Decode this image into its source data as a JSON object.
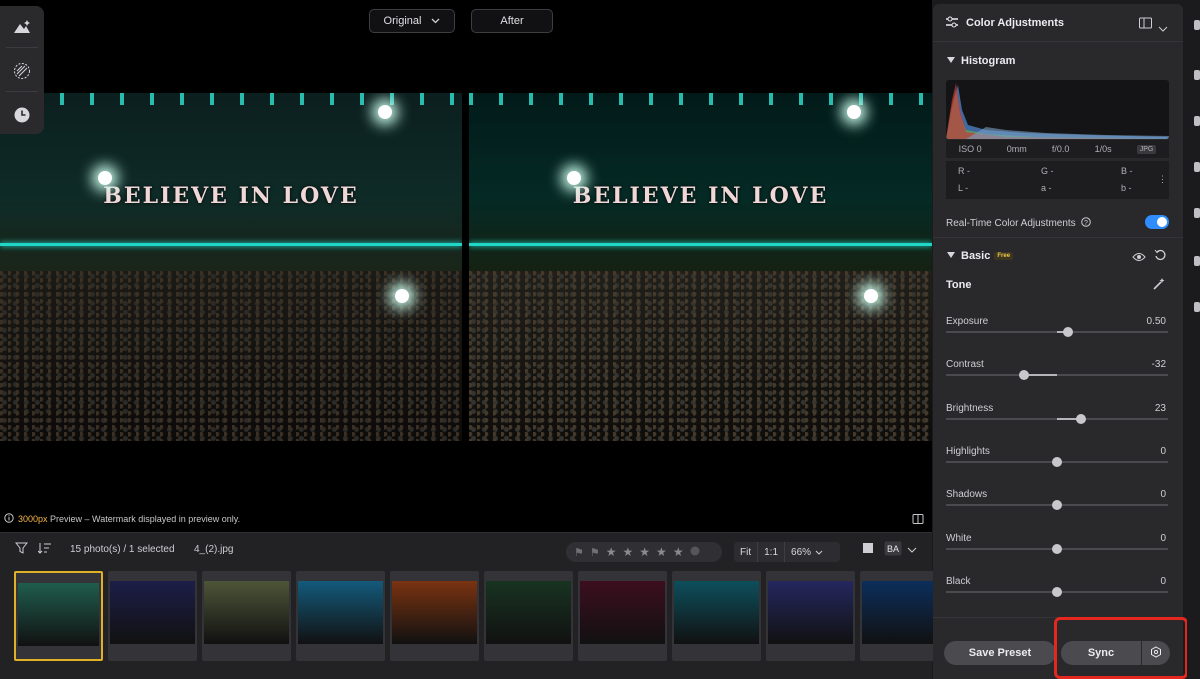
{
  "preview": {
    "compare_mode": "Original",
    "after_label": "After",
    "banner_text": "BELIEVE IN LOVE",
    "info_highlight": "3000px",
    "info_text": " Preview – Watermark displayed in preview only."
  },
  "filmstrip": {
    "count_text": "15 photo(s) / 1 selected",
    "filename": "4_(2).jpg",
    "zoom_fit": "Fit",
    "zoom_1to1": "1:1",
    "zoom_pct": "66%",
    "thumb_colors": [
      "#1f5d4c",
      "#1c1e48",
      "#4d5538",
      "#135a7b",
      "#7a3311",
      "#183321",
      "#3c0e1e",
      "#0d4f5c",
      "#24275e",
      "#0c2e5b"
    ]
  },
  "panel": {
    "title": "Color Adjustments",
    "histogram_title": "Histogram",
    "exif": [
      "ISO 0",
      "0mm",
      "f/0.0",
      "1/0s"
    ],
    "exif_format": "JPG",
    "rgb": {
      "r": "R -",
      "g": "G -",
      "b": "B -",
      "l": "L -",
      "a": "a -",
      "b2": "b -"
    },
    "realtime_label": "Real-Time Color Adjustments",
    "basic_title": "Basic",
    "basic_badge": "Free",
    "tone_title": "Tone",
    "sliders": [
      {
        "label": "Exposure",
        "value": "0.50"
      },
      {
        "label": "Contrast",
        "value": "-32"
      },
      {
        "label": "Brightness",
        "value": "23"
      },
      {
        "label": "Highlights",
        "value": "0"
      },
      {
        "label": "Shadows",
        "value": "0"
      },
      {
        "label": "White",
        "value": "0"
      },
      {
        "label": "Black",
        "value": "0"
      }
    ],
    "save_preset": "Save Preset",
    "sync": "Sync",
    "accent": "#2f8dff",
    "highlight_box_color": "#e4271f"
  }
}
